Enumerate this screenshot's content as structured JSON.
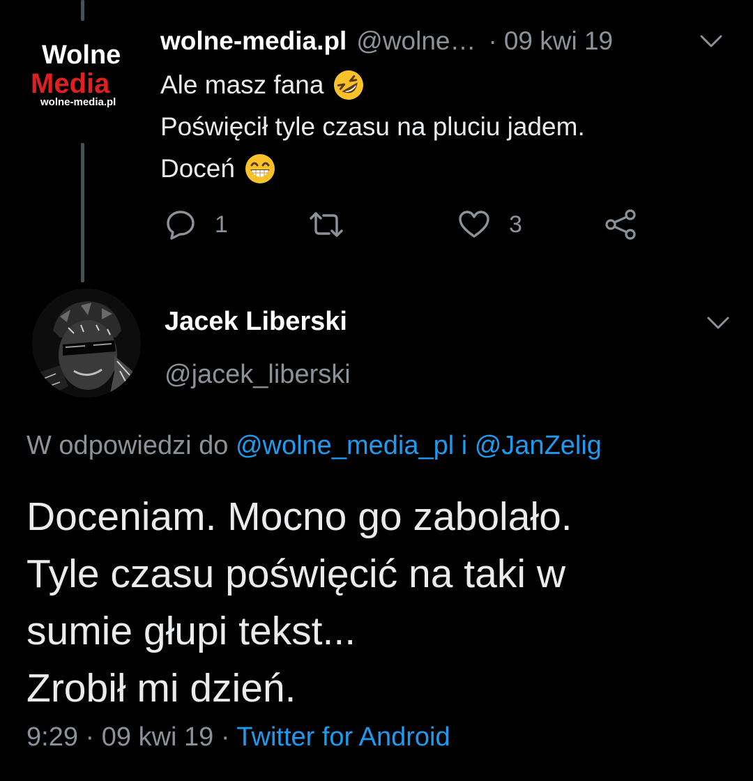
{
  "tweet1": {
    "logo": {
      "line1": "Wolne",
      "line2": "Media",
      "url": "wolne-media.pl"
    },
    "name": "wolne-media.pl",
    "handle": "@wolne…",
    "separator": "·",
    "date": "09 kwi 19",
    "text_lines": [
      "Ale masz fana",
      "Poświęcił tyle czasu na pluciu jadem.",
      "Doceń"
    ],
    "line_emojis": [
      "rolling-on-floor-laughing-emoji",
      "grinning-face-emoji"
    ],
    "actions": {
      "reply_count": "1",
      "retweet_count": "",
      "like_count": "3"
    }
  },
  "tweet2": {
    "name": "Jacek Liberski",
    "handle": "@jacek_liberski",
    "reply_prefix": "W odpowiedzi do",
    "reply_mention1": "@wolne_media_pl",
    "reply_conjunction": "i",
    "reply_mention2": "@JanZelig",
    "text_lines": [
      "Doceniam. Mocno go zabolało.",
      "Tyle czasu poświęcić na taki w",
      "sumie głupi tekst...",
      "Zrobił mi dzień."
    ],
    "time": "9:29",
    "separator": "·",
    "date": "09 kwi 19",
    "source": "Twitter for Android"
  },
  "colors": {
    "background": "#000000",
    "secondary_text": "#8b9299",
    "link": "#1d9bf0",
    "brand_red": "#e02020"
  }
}
